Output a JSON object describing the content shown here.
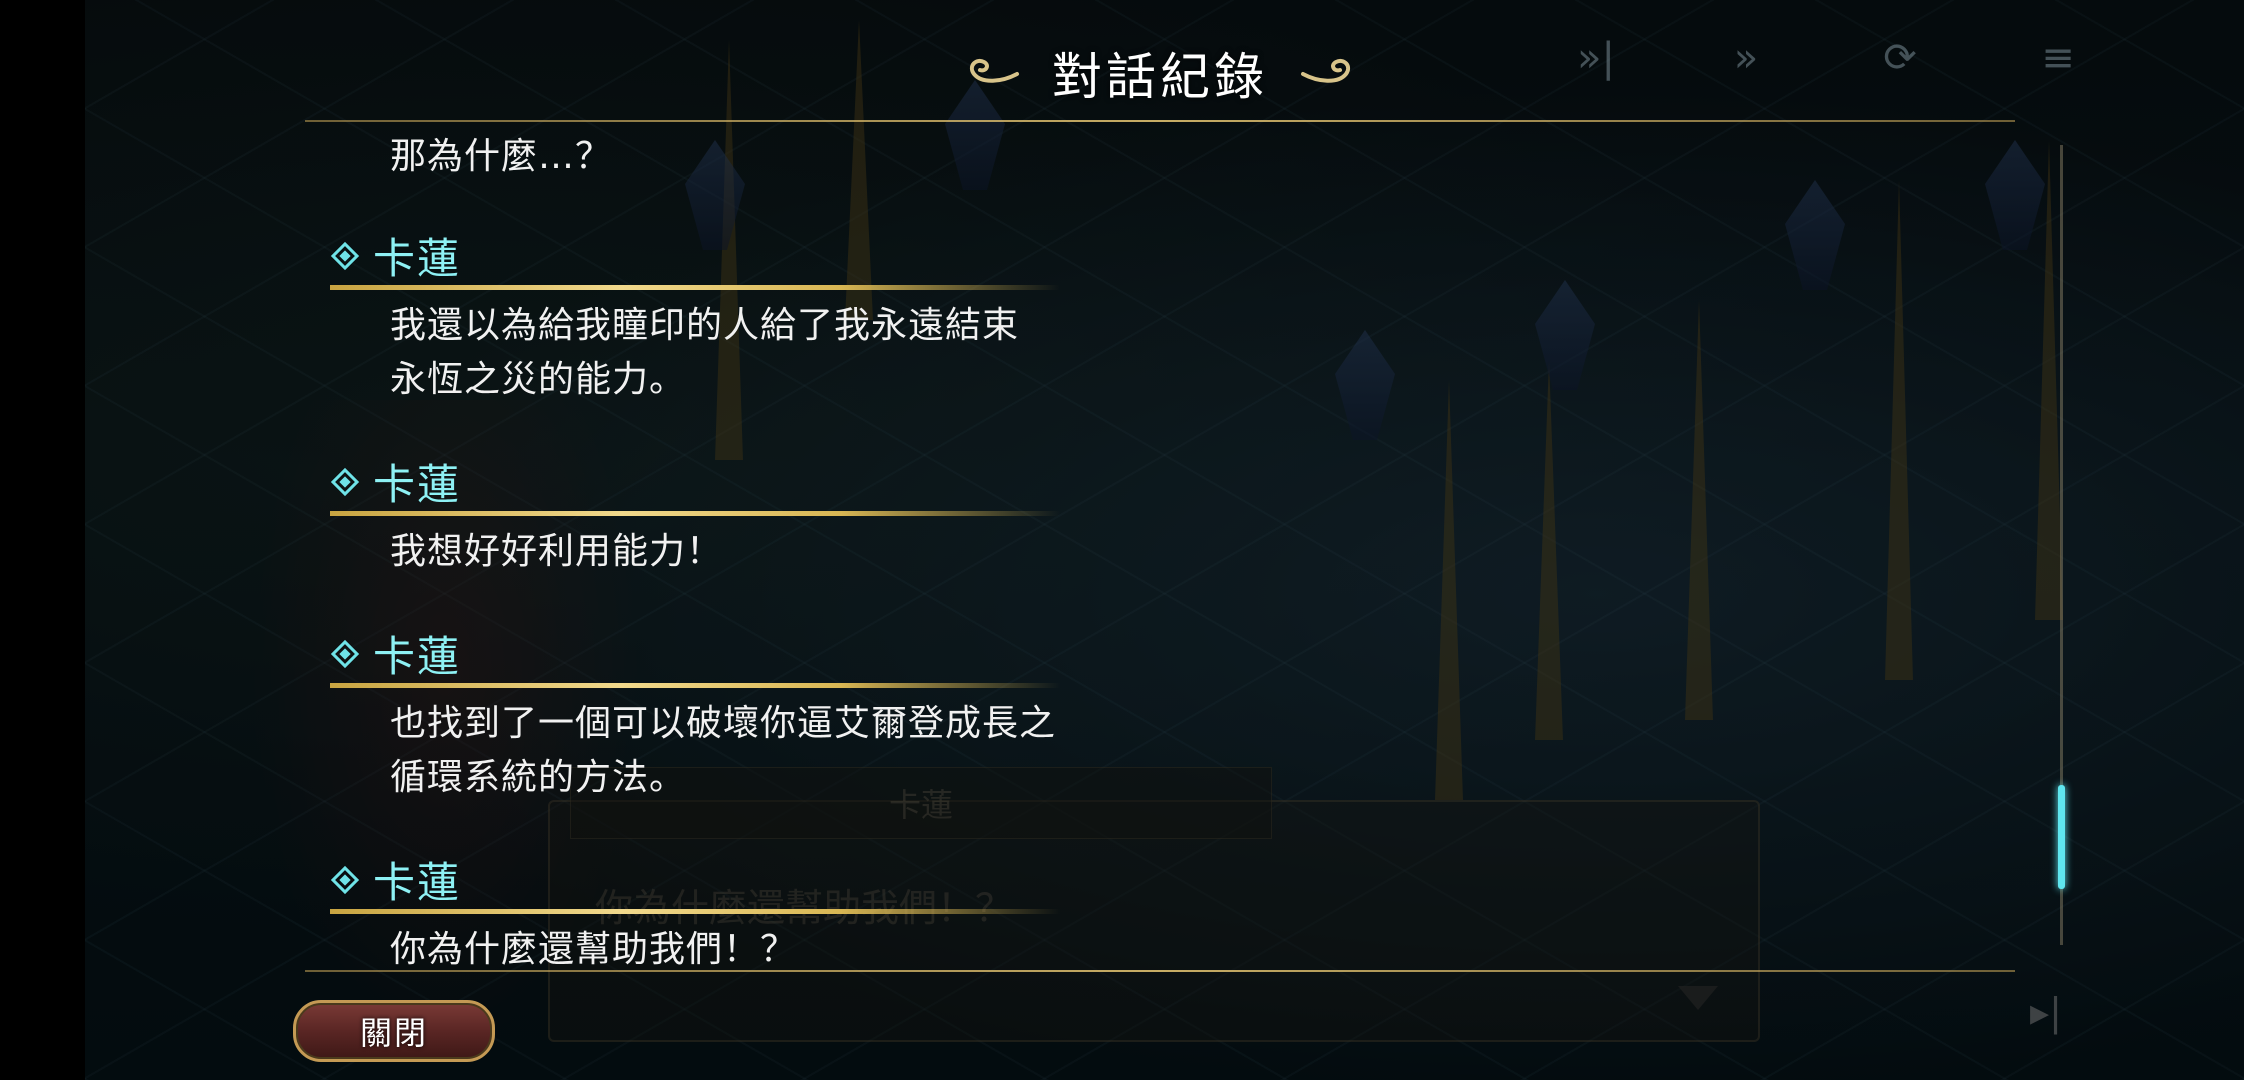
{
  "header": {
    "title": "對話紀錄"
  },
  "controls": {
    "skip_icon": "»|",
    "fast_forward_icon": "»",
    "auto_icon": "⟳",
    "menu_icon": "≡"
  },
  "background_dialog": {
    "speaker": "卡蓮",
    "text": "你為什麼還幫助我們！？"
  },
  "log": [
    {
      "speaker": "",
      "lines": [
        "那為什麼…？"
      ]
    },
    {
      "speaker": "卡蓮",
      "lines": [
        "我還以為給我瞳印的人給了我永遠結束",
        "永恆之災的能力。"
      ]
    },
    {
      "speaker": "卡蓮",
      "lines": [
        "我想好好利用能力！"
      ]
    },
    {
      "speaker": "卡蓮",
      "lines": [
        "也找到了一個可以破壞你逼艾爾登成長之",
        "循環系統的方法。"
      ]
    },
    {
      "speaker": "卡蓮",
      "lines": [
        "你為什麼還幫助我們！？"
      ]
    }
  ],
  "scroll": {
    "position_fraction": 0.92,
    "thumb_fraction": 0.13
  },
  "footer": {
    "close_label": "關閉",
    "skip_end_icon": "▸|"
  },
  "colors": {
    "speaker_name": "#8ef1f4",
    "underline_gold": "#e0c062",
    "scroll_thumb": "#5fe6ef"
  }
}
